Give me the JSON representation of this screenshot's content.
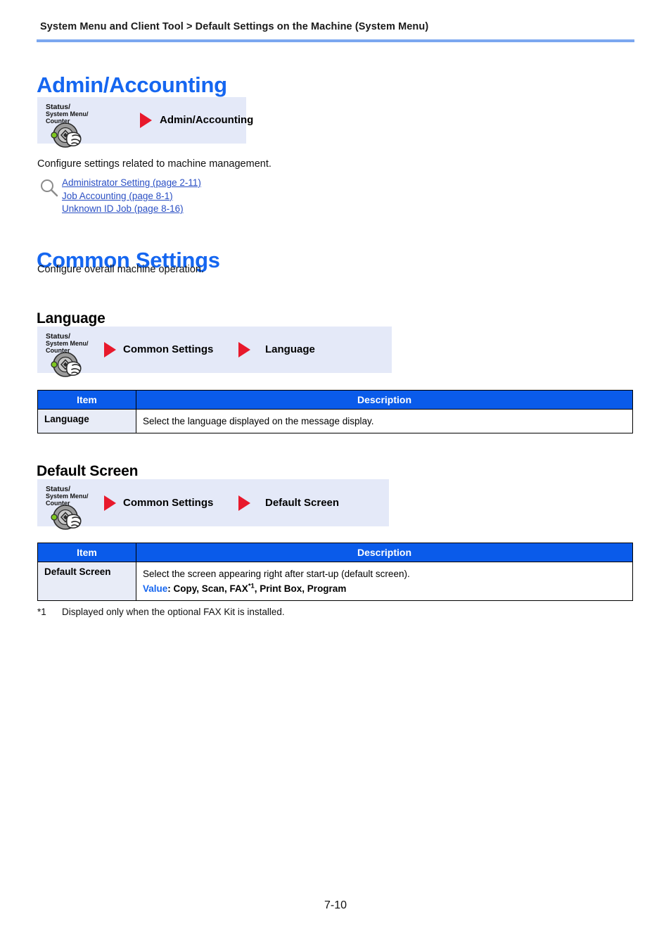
{
  "header": {
    "breadcrumb": "System Menu and Client Tool > Default Settings on the Machine (System Menu)"
  },
  "sections": {
    "admin": {
      "title": "Admin/Accounting",
      "keypath": {
        "key_label_line1": "Status/",
        "key_label_line2": "System Menu/",
        "key_label_line3": "Counter",
        "steps": [
          "Admin/Accounting"
        ]
      },
      "description": "Configure settings related to machine management.",
      "references": [
        "Administrator Setting (page 2-11)",
        "Job Accounting (page 8-1)",
        "Unknown ID Job (page 8-16)"
      ]
    },
    "common": {
      "title": "Common Settings",
      "description": "Configure overall machine operation.",
      "subsections": [
        {
          "title": "Language",
          "keypath": {
            "key_label_line1": "Status/",
            "key_label_line2": "System Menu/",
            "key_label_line3": "Counter",
            "steps": [
              "Common Settings",
              "Language"
            ]
          },
          "table": {
            "headers": [
              "Item",
              "Description"
            ],
            "rows": [
              {
                "item": "Language",
                "description": "Select the language displayed on the message display.",
                "value_label": "",
                "value_text": ""
              }
            ]
          }
        },
        {
          "title": "Default Screen",
          "keypath": {
            "key_label_line1": "Status/",
            "key_label_line2": "System Menu/",
            "key_label_line3": "Counter",
            "steps": [
              "Common Settings",
              "Default Screen"
            ]
          },
          "table": {
            "headers": [
              "Item",
              "Description"
            ],
            "rows": [
              {
                "item": "Default Screen",
                "description": "Select the screen appearing right after start-up (default screen).",
                "value_label": "Value",
                "value_text_pre": ": Copy, Scan, FAX",
                "value_superscript": "*1",
                "value_text_post": ", Print Box, Program"
              }
            ]
          }
        }
      ]
    }
  },
  "footnote": {
    "mark": "*1",
    "text": "Displayed only when the optional FAX Kit is installed."
  },
  "page_number": "7-10",
  "colors": {
    "heading_blue": "#1566f0",
    "rule_blue": "#7ba7f0",
    "keybox_bg": "#e4e9f8",
    "table_header_blue": "#0a5bea",
    "item_cell_bg": "#e8ecf7",
    "arrow_red": "#e8192c",
    "link_blue": "#2a4fc4"
  }
}
